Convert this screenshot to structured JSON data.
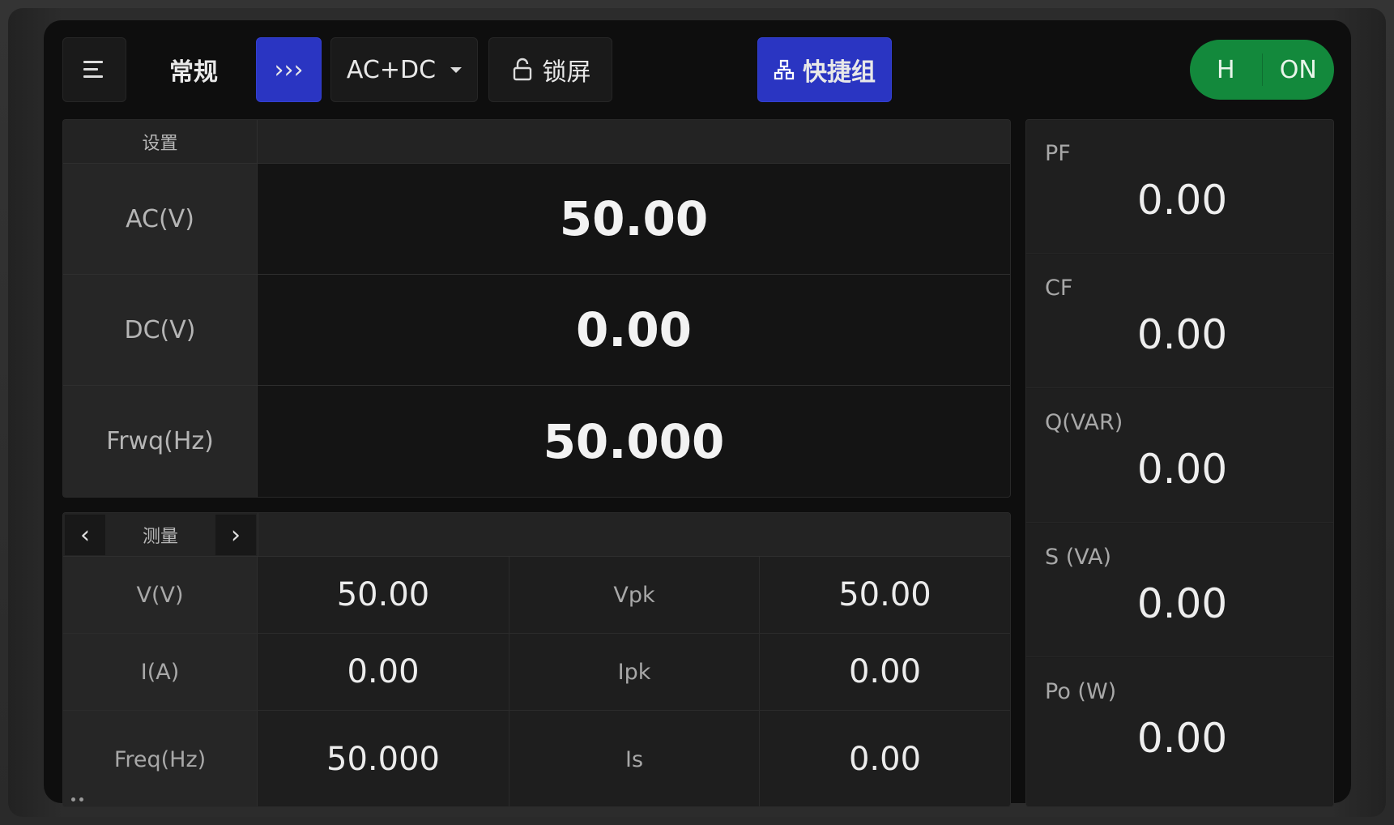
{
  "toolbar": {
    "mode_title": "常规",
    "expand_icon_text": "›››",
    "coupling": "AC+DC",
    "lock_label": "锁屏",
    "quick_group_label": "快捷组",
    "power_range": "H",
    "output_state": "ON"
  },
  "settings": {
    "header": "设置",
    "rows": [
      {
        "label": "AC(V)",
        "value": "50.00"
      },
      {
        "label": "DC(V)",
        "value": "0.00"
      },
      {
        "label": "Frwq(Hz)",
        "value": "50.000"
      }
    ]
  },
  "measure": {
    "header": "测量",
    "prev": "‹",
    "next": "›",
    "rows": [
      {
        "label1": "V(V)",
        "value1": "50.00",
        "label2": "Vpk",
        "value2": "50.00"
      },
      {
        "label1": "I(A)",
        "value1": "0.00",
        "label2": "Ipk",
        "value2": "0.00"
      },
      {
        "label1": "Freq(Hz)",
        "value1": "50.000",
        "label2": "Is",
        "value2": "0.00"
      }
    ]
  },
  "readings": [
    {
      "label": "PF",
      "value": "0.00"
    },
    {
      "label": "CF",
      "value": "0.00"
    },
    {
      "label": "Q(VAR)",
      "value": "0.00"
    },
    {
      "label": "S (VA)",
      "value": "0.00"
    },
    {
      "label": "Po (W)",
      "value": "0.00"
    }
  ],
  "colors": {
    "accent_blue": "#2a35c2",
    "output_on_green": "#13893c",
    "screen_bg": "#0e0e0e"
  }
}
